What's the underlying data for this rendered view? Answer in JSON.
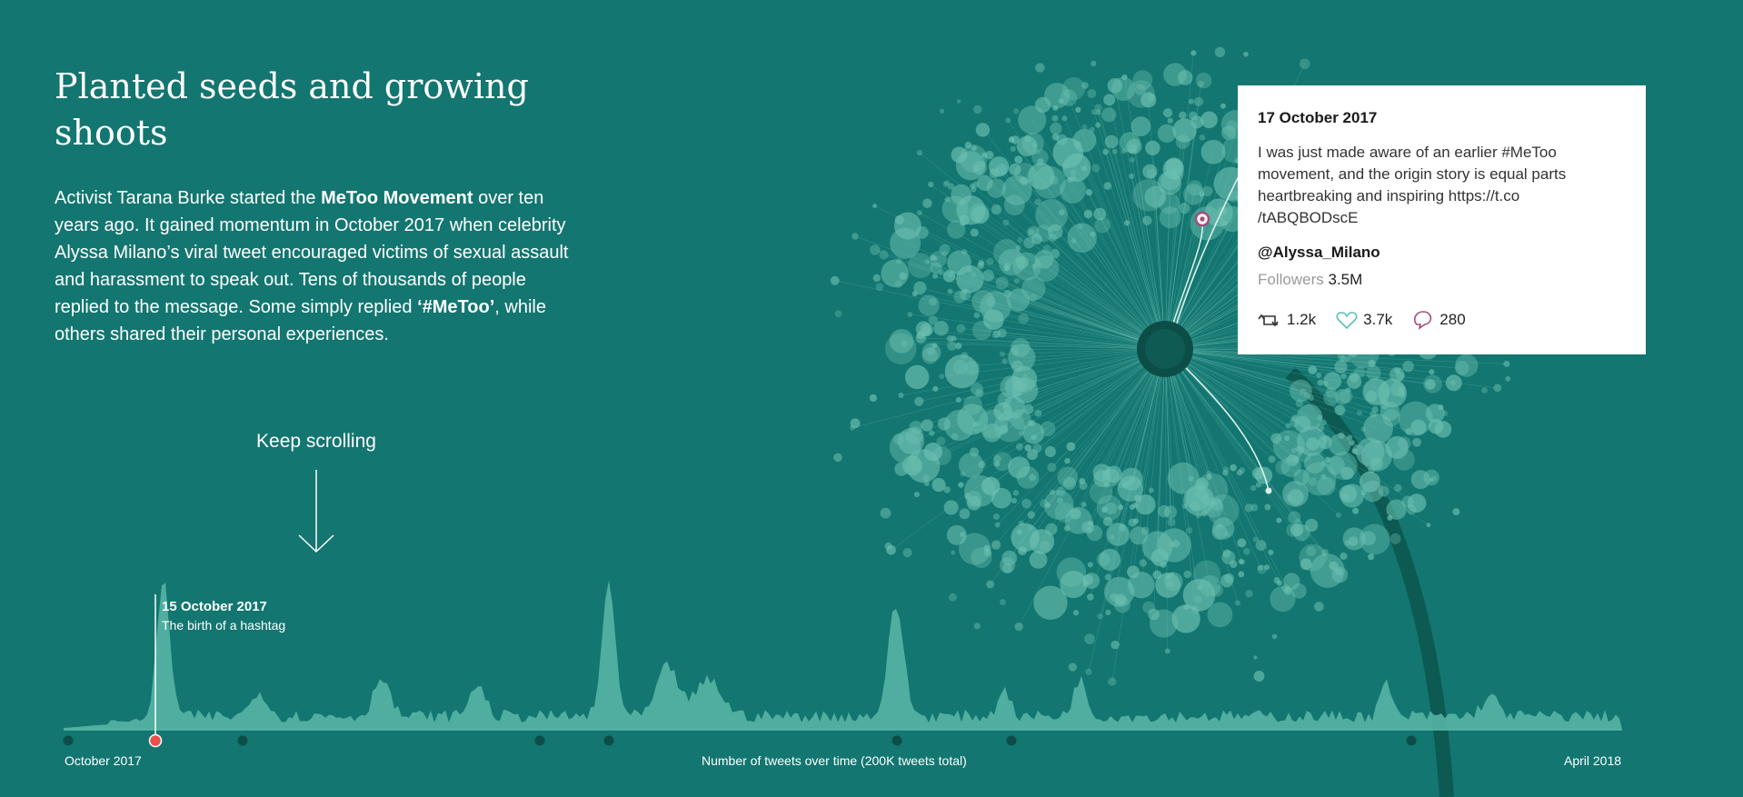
{
  "story": {
    "title": "Planted seeds and growing shoots",
    "intro_part1": "Activist Tarana Burke started the ",
    "intro_bold1": "MeToo Movement",
    "intro_part2": " over ten years ago. It gained momentum in October 2017 when celebrity Alyssa Milano’s viral tweet encouraged victims of sexual assault and harassment to speak out. Tens of thousands of people replied to the message. Some simply replied ",
    "intro_bold2": "‘#MeToo’",
    "intro_part3": ", while others shared their personal experiences."
  },
  "scroll_hint": {
    "label": "Keep scrolling"
  },
  "timeline": {
    "start_label": "October 2017",
    "end_label": "April 2018",
    "axis_label": "Number of tweets over time (200K tweets total)",
    "annotation": {
      "date": "15 October 2017",
      "text": "The birth of a hashtag"
    }
  },
  "tweet": {
    "date": "17 October 2017",
    "text_line1": "I was just made aware of an earlier #MeToo",
    "text_line2": "movement, and the origin story is equal parts",
    "text_line3": "heartbreaking and inspiring https://t.co",
    "text_line4": "/tABQBODscE",
    "handle": "@Alyssa_Milano",
    "followers_label": "Followers",
    "followers_value": "3.5M",
    "retweets": "1.2k",
    "likes": "3.7k",
    "replies": "280"
  },
  "colors": {
    "background": "#137670",
    "area": "#5bb8a8",
    "dark_node": "#0c4e47",
    "highlight": "#e8504f",
    "bubble": "#6bbfb0"
  },
  "icons": [
    "arrow-down-icon",
    "retweet-icon",
    "heart-icon",
    "reply-icon"
  ]
}
